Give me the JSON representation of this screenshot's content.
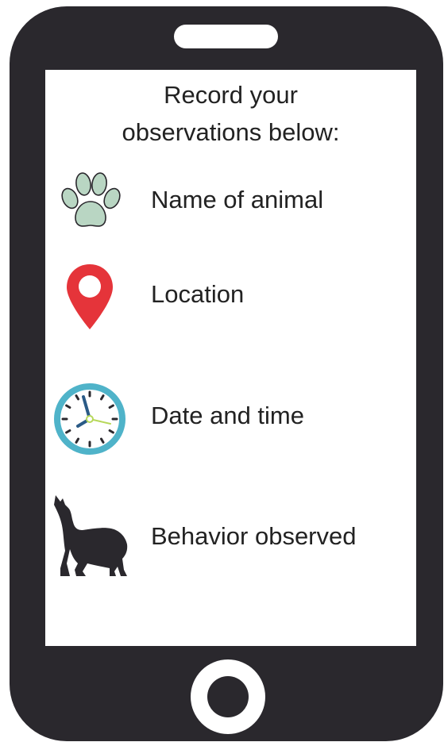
{
  "heading": {
    "line1": "Record your",
    "line2": "observations below:"
  },
  "items": [
    {
      "label": "Name of animal",
      "icon": "paw-icon"
    },
    {
      "label": "Location",
      "icon": "location-pin-icon"
    },
    {
      "label": "Date and time",
      "icon": "clock-icon"
    },
    {
      "label": "Behavior observed",
      "icon": "howling-wolf-icon"
    }
  ],
  "colors": {
    "phone_body": "#2a282d",
    "paw_fill": "#b9d6c3",
    "pin_red": "#e5343a",
    "clock_ring": "#4fb3c9",
    "wolf": "#2a282d",
    "text": "#222222"
  }
}
